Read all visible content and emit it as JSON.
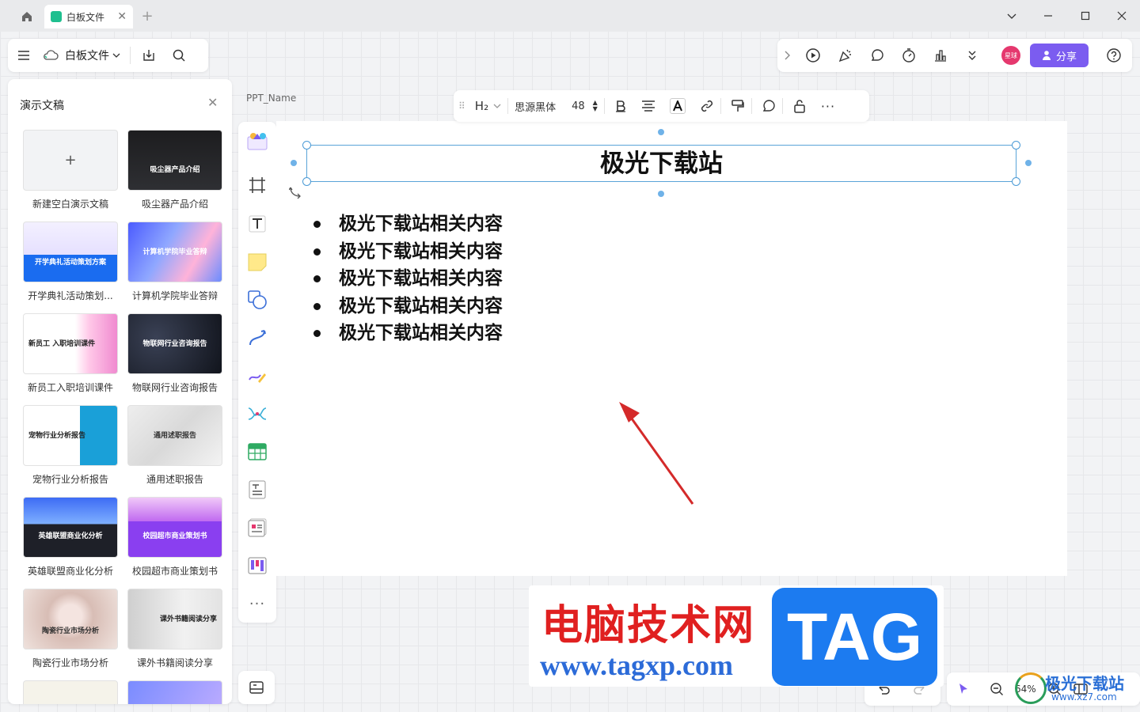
{
  "titlebar": {
    "tab_label": "白板文件"
  },
  "topbar": {
    "file_name": "白板文件"
  },
  "topright": {
    "avatar_text": "星球",
    "share_label": "分享"
  },
  "panel": {
    "title": "演示文稿",
    "new_plus": "+",
    "templates": [
      {
        "label": "新建空白演示文稿",
        "thumb_text": ""
      },
      {
        "label": "吸尘器产品介绍",
        "thumb_text": "吸尘器产品介绍"
      },
      {
        "label": "开学典礼活动策划...",
        "thumb_text": "开学典礼活动策划方案"
      },
      {
        "label": "计算机学院毕业答辩",
        "thumb_text": "计算机学院毕业答辩"
      },
      {
        "label": "新员工入职培训课件",
        "thumb_text": "新员工 入职培训课件"
      },
      {
        "label": "物联网行业咨询报告",
        "thumb_text": "物联网行业咨询报告"
      },
      {
        "label": "宠物行业分析报告",
        "thumb_text": "宠物行业分析报告"
      },
      {
        "label": "通用述职报告",
        "thumb_text": "通用述职报告"
      },
      {
        "label": "英雄联盟商业化分析",
        "thumb_text": "英雄联盟商业化分析"
      },
      {
        "label": "校园超市商业策划书",
        "thumb_text": "校园超市商业策划书"
      },
      {
        "label": "陶瓷行业市场分析",
        "thumb_text": "陶瓷行业市场分析"
      },
      {
        "label": "课外书籍阅读分享",
        "thumb_text": "课外书籍阅读分享"
      }
    ]
  },
  "canvas": {
    "ppt_name": "PPT_Name",
    "heading": "极光下载站",
    "bullets": [
      "极光下载站相关内容",
      "极光下载站相关内容",
      "极光下载站相关内容",
      "极光下载站相关内容",
      "极光下载站相关内容"
    ]
  },
  "text_toolbar": {
    "heading_level": "H₂",
    "font_name": "思源黑体",
    "font_size": "48"
  },
  "zoom": {
    "level": "64%"
  },
  "watermark": {
    "title": "电脑技术网",
    "url": "www.tagxp.com",
    "tag": "TAG",
    "site2_title": "极光下载站",
    "site2_url": "www.xz7.com"
  },
  "colors": {
    "accent": "#7b5cf0",
    "selection": "#5aa4d8",
    "arrow": "#d42a2a"
  }
}
